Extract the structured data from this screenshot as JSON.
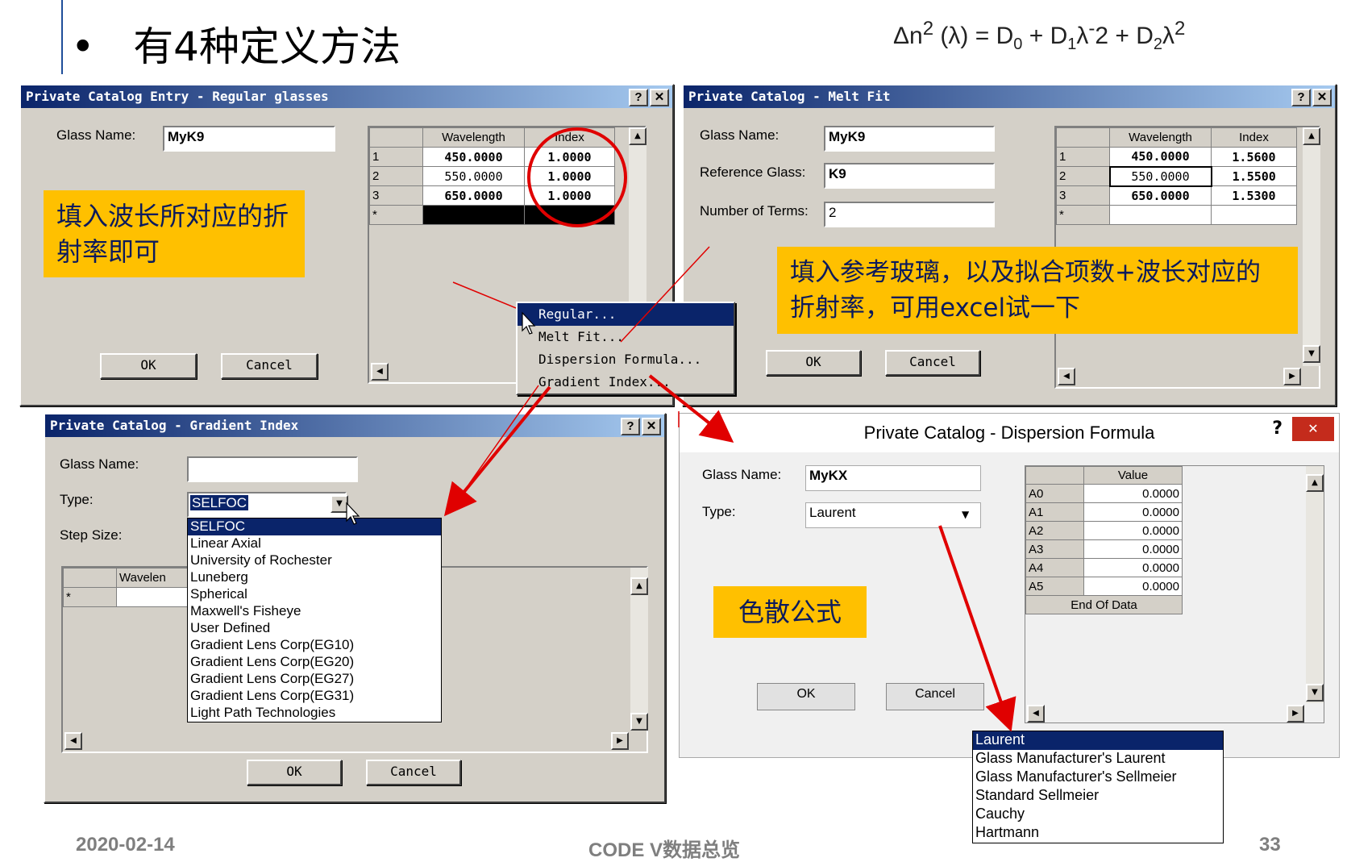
{
  "header": {
    "bullet": "•",
    "title": "有4种定义方法"
  },
  "formula": {
    "lhs": "Δn",
    "sup1": "2",
    "arg": " (λ) = D",
    "sub0": "0",
    "p1": " + D",
    "sub1": "1",
    "p2": "λ",
    "sup2": "-",
    "p3": "2 + D",
    "sub2": "2",
    "p4": "λ",
    "sup3": "2"
  },
  "regular": {
    "title": "Private Catalog Entry - Regular glasses",
    "help": "?",
    "close": "✕",
    "glass_label": "Glass Name:",
    "glass_value": "MyK9",
    "cols": [
      "Wavelength",
      "Index"
    ],
    "rows": [
      {
        "num": "1",
        "wl": "450.0000",
        "idx": "1.0000"
      },
      {
        "num": "2",
        "wl": "550.0000",
        "idx": "1.0000"
      },
      {
        "num": "3",
        "wl": "650.0000",
        "idx": "1.0000"
      }
    ],
    "new_row": "*",
    "ok": "OK",
    "cancel": "Cancel",
    "note": "填入波长所对应的折射率即可"
  },
  "menu": {
    "items": [
      "Regular...",
      "Melt Fit...",
      "Dispersion Formula...",
      "Gradient Index..."
    ]
  },
  "melt": {
    "title": "Private Catalog - Melt Fit",
    "help": "?",
    "close": "✕",
    "glass_label": "Glass Name:",
    "glass_value": "MyK9",
    "ref_label": "Reference Glass:",
    "ref_value": "K9",
    "terms_label": "Number of Terms:",
    "terms_value": "2",
    "cols": [
      "Wavelength",
      "Index"
    ],
    "rows": [
      {
        "num": "1",
        "wl": "450.0000",
        "idx": "1.5600"
      },
      {
        "num": "2",
        "wl": "550.0000",
        "idx": "1.5500"
      },
      {
        "num": "3",
        "wl": "650.0000",
        "idx": "1.5300"
      }
    ],
    "new_row": "*",
    "ok": "OK",
    "cancel": "Cancel",
    "note": "填入参考玻璃，以及拟合项数+波长对应的折射率，可用excel试一下"
  },
  "gradient": {
    "title": "Private Catalog - Gradient Index",
    "help": "?",
    "close": "✕",
    "glass_label": "Glass Name:",
    "glass_value": "",
    "type_label": "Type:",
    "type_value": "SELFOC",
    "step_label": "Step Size:",
    "col": "Wavelen",
    "new_row": "*",
    "options": [
      "SELFOC",
      "Linear Axial",
      "University of Rochester",
      "Luneberg",
      "Spherical",
      "Maxwell's Fisheye",
      "User Defined",
      "Gradient Lens Corp(EG10)",
      "Gradient Lens Corp(EG20)",
      "Gradient Lens Corp(EG27)",
      "Gradient Lens Corp(EG31)",
      "Light Path Technologies"
    ],
    "ok": "OK",
    "cancel": "Cancel"
  },
  "dispersion": {
    "title": "Private Catalog - Dispersion Formula",
    "help": "?",
    "close": "✕",
    "glass_label": "Glass Name:",
    "glass_value": "MyKX",
    "type_label": "Type:",
    "type_value": "Laurent",
    "col": "Value",
    "rows": [
      {
        "name": "A0",
        "val": "0.0000"
      },
      {
        "name": "A1",
        "val": "0.0000"
      },
      {
        "name": "A2",
        "val": "0.0000"
      },
      {
        "name": "A3",
        "val": "0.0000"
      },
      {
        "name": "A4",
        "val": "0.0000"
      },
      {
        "name": "A5",
        "val": "0.0000"
      }
    ],
    "end": "End Of Data",
    "ok": "OK",
    "cancel": "Cancel",
    "note": "色散公式",
    "options": [
      "Laurent",
      "Glass Manufacturer's Laurent",
      "Glass Manufacturer's Sellmeier",
      "Standard Sellmeier",
      "Cauchy",
      "Hartmann"
    ]
  },
  "footer": {
    "date": "2020-02-14",
    "center": "CODE V数据总览",
    "page": "33"
  },
  "colors": {
    "accent": "#0a246a",
    "note_bg": "#ffc000",
    "arrow": "#e00000"
  }
}
